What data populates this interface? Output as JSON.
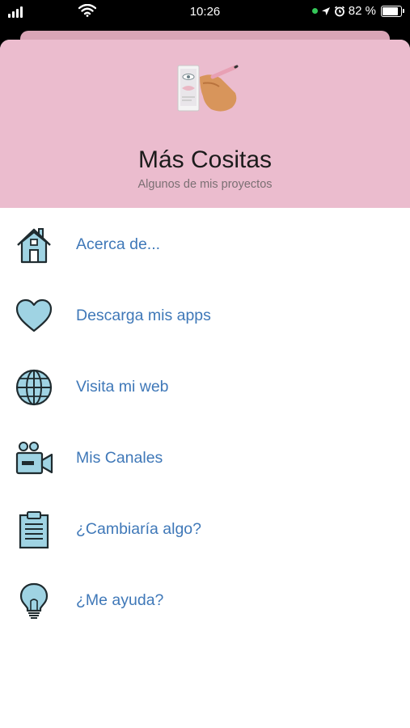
{
  "status_bar": {
    "time": "10:26",
    "battery": "82 %",
    "icons": [
      "signal-icon",
      "wifi-icon",
      "location-dot-icon",
      "location-arrow-icon",
      "alarm-icon",
      "battery-icon"
    ]
  },
  "header": {
    "title": "Más Cositas",
    "subtitle": "Algunos de mis proyectos",
    "background": "#ebbcce"
  },
  "menu": {
    "link_color": "#3f78b8",
    "icon_fill": "#9fd3e3",
    "items": [
      {
        "label": "Acerca de...",
        "icon": "house-icon"
      },
      {
        "label": "Descarga mis apps",
        "icon": "heart-icon"
      },
      {
        "label": "Visita mi web",
        "icon": "globe-icon"
      },
      {
        "label": "Mis Canales",
        "icon": "video-camera-icon"
      },
      {
        "label": "¿Cambiaría algo?",
        "icon": "clipboard-icon"
      },
      {
        "label": "¿Me ayuda?",
        "icon": "lightbulb-icon"
      }
    ]
  }
}
